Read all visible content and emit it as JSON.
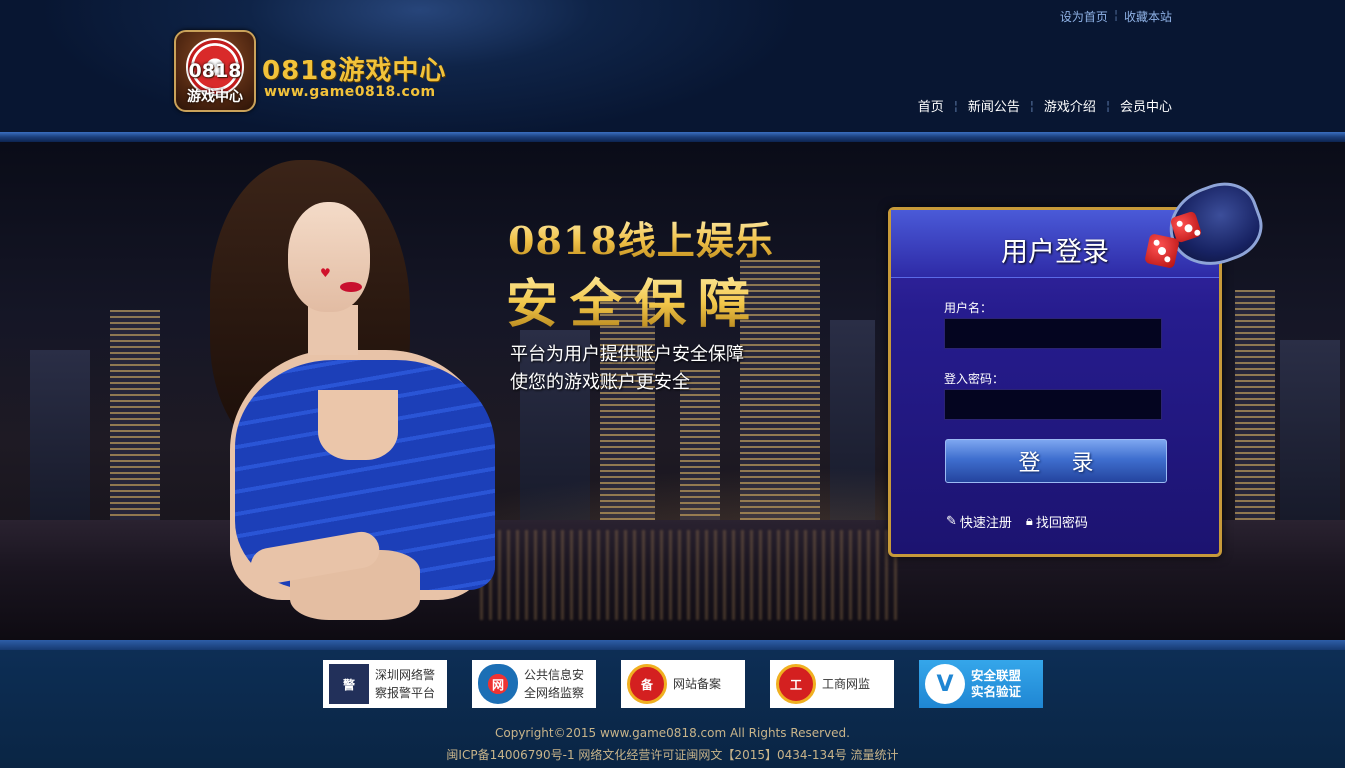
{
  "top_links": {
    "set_home": "设为首页",
    "bookmark": "收藏本站"
  },
  "logo": {
    "number": "0818",
    "cn": "游戏中心",
    "title": "0818游戏中心",
    "url": "www.game0818.com"
  },
  "nav": {
    "items": [
      "首页",
      "新闻公告",
      "游戏介绍",
      "会员中心"
    ]
  },
  "banner": {
    "headline1": "0818线上娱乐",
    "headline2": "安全保障",
    "sub1": "平台为用户提供账户安全保障",
    "sub2": "使您的游戏账户更安全"
  },
  "login": {
    "title": "用户登录",
    "username_label": "用户名：",
    "username_value": "",
    "password_label": "登入密码：",
    "password_value": "",
    "submit": "登 录",
    "register": "快速注册",
    "recover": "找回密码"
  },
  "footer": {
    "badges": [
      {
        "line1": "深圳网络警",
        "line2": "察报警平台",
        "icon": "police-icon"
      },
      {
        "line1": "公共信息安",
        "line2": "全网络监察",
        "icon": "shield-icon"
      },
      {
        "line1": "网站备案",
        "line2": "",
        "icon": "record-seal-icon"
      },
      {
        "line1": "工商网监",
        "line2": "",
        "icon": "commerce-seal-icon"
      },
      {
        "line1": "安全联盟",
        "line2": "实名验证",
        "icon": "verify-v-icon"
      }
    ],
    "copyright": "Copyright©2015 www.game0818.com All Rights Reserved.",
    "icp": "闽ICP备14006790号-1 网络文化经营许可证闽网文【2015】0434-134号 流量统计"
  },
  "colors": {
    "gold": "#f2c23a",
    "panel": "#261c8e",
    "panel_border": "#c79a3a",
    "footer_bg": "#0d2e55",
    "button_blue": "#3f6fcf"
  }
}
